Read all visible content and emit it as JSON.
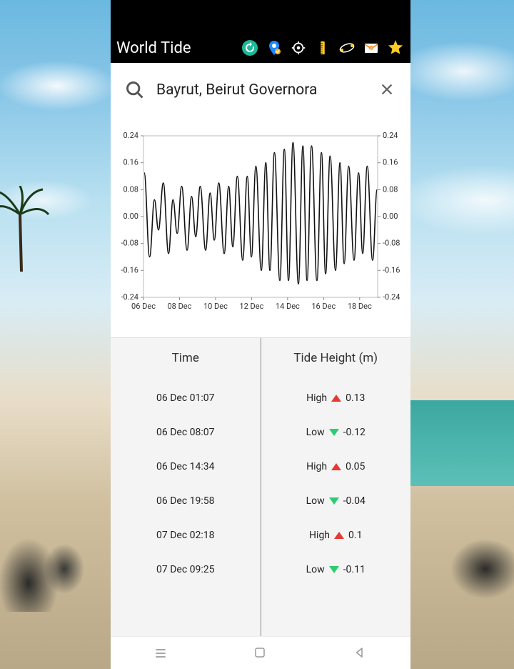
{
  "header": {
    "title": "World Tide"
  },
  "search": {
    "value": "Bayrut, Beirut Governora"
  },
  "table": {
    "headers": {
      "time": "Time",
      "height": "Tide Height (m)"
    },
    "rows": [
      {
        "time": "06 Dec 01:07",
        "kind": "High",
        "height": "0.13"
      },
      {
        "time": "06 Dec 08:07",
        "kind": "Low",
        "height": "-0.12"
      },
      {
        "time": "06 Dec 14:34",
        "kind": "High",
        "height": "0.05"
      },
      {
        "time": "06 Dec 19:58",
        "kind": "Low",
        "height": "-0.04"
      },
      {
        "time": "07 Dec 02:18",
        "kind": "High",
        "height": "0.1"
      },
      {
        "time": "07 Dec 09:25",
        "kind": "Low",
        "height": "-0.11"
      }
    ]
  },
  "chart_data": {
    "type": "line",
    "title": "",
    "xlabel": "",
    "ylabel": "",
    "ylim": [
      -0.24,
      0.24
    ],
    "y_ticks": [
      -0.24,
      -0.16,
      -0.08,
      0.0,
      0.08,
      0.16,
      0.24
    ],
    "x_tick_labels": [
      "06 Dec",
      "08 Dec",
      "10 Dec",
      "12 Dec",
      "14 Dec",
      "16 Dec",
      "18 Dec"
    ],
    "x_range_days": [
      0,
      13
    ],
    "series": [
      {
        "name": "tide",
        "points": [
          {
            "t": 0.04,
            "h": 0.13
          },
          {
            "t": 0.34,
            "h": -0.12
          },
          {
            "t": 0.61,
            "h": 0.05
          },
          {
            "t": 0.83,
            "h": -0.04
          },
          {
            "t": 1.1,
            "h": 0.1
          },
          {
            "t": 1.39,
            "h": -0.11
          },
          {
            "t": 1.64,
            "h": 0.05
          },
          {
            "t": 1.87,
            "h": -0.05
          },
          {
            "t": 2.12,
            "h": 0.09
          },
          {
            "t": 2.42,
            "h": -0.1
          },
          {
            "t": 2.67,
            "h": 0.06
          },
          {
            "t": 2.9,
            "h": -0.06
          },
          {
            "t": 3.15,
            "h": 0.09
          },
          {
            "t": 3.45,
            "h": -0.1
          },
          {
            "t": 3.7,
            "h": 0.07
          },
          {
            "t": 3.93,
            "h": -0.07
          },
          {
            "t": 4.18,
            "h": 0.1
          },
          {
            "t": 4.48,
            "h": -0.11
          },
          {
            "t": 4.73,
            "h": 0.09
          },
          {
            "t": 4.96,
            "h": -0.09
          },
          {
            "t": 5.21,
            "h": 0.12
          },
          {
            "t": 5.51,
            "h": -0.13
          },
          {
            "t": 5.76,
            "h": 0.12
          },
          {
            "t": 5.99,
            "h": -0.12
          },
          {
            "t": 6.24,
            "h": 0.15
          },
          {
            "t": 6.54,
            "h": -0.16
          },
          {
            "t": 6.79,
            "h": 0.16
          },
          {
            "t": 7.02,
            "h": -0.16
          },
          {
            "t": 7.27,
            "h": 0.19
          },
          {
            "t": 7.57,
            "h": -0.19
          },
          {
            "t": 7.82,
            "h": 0.2
          },
          {
            "t": 8.05,
            "h": -0.19
          },
          {
            "t": 8.3,
            "h": 0.22
          },
          {
            "t": 8.6,
            "h": -0.2
          },
          {
            "t": 8.85,
            "h": 0.21
          },
          {
            "t": 9.08,
            "h": -0.19
          },
          {
            "t": 9.33,
            "h": 0.21
          },
          {
            "t": 9.63,
            "h": -0.19
          },
          {
            "t": 9.88,
            "h": 0.19
          },
          {
            "t": 10.11,
            "h": -0.17
          },
          {
            "t": 10.36,
            "h": 0.18
          },
          {
            "t": 10.66,
            "h": -0.16
          },
          {
            "t": 10.91,
            "h": 0.16
          },
          {
            "t": 11.14,
            "h": -0.14
          },
          {
            "t": 11.39,
            "h": 0.15
          },
          {
            "t": 11.69,
            "h": -0.13
          },
          {
            "t": 11.94,
            "h": 0.13
          },
          {
            "t": 12.17,
            "h": -0.11
          },
          {
            "t": 12.42,
            "h": 0.15
          },
          {
            "t": 12.72,
            "h": -0.13
          },
          {
            "t": 12.97,
            "h": 0.08
          }
        ]
      }
    ]
  }
}
